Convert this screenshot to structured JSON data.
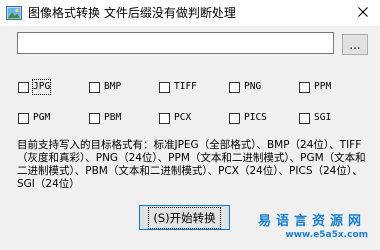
{
  "window": {
    "title": "图像格式转换 文件后缀没有做判断处理",
    "app_icon": "image-app-icon",
    "close_icon": "close-icon"
  },
  "path_input": {
    "value": "",
    "placeholder": ""
  },
  "browse_button": {
    "label": "..."
  },
  "formats": {
    "row1": [
      {
        "label": "JPG",
        "checked": false
      },
      {
        "label": "BMP",
        "checked": false
      },
      {
        "label": "TIFF",
        "checked": false
      },
      {
        "label": "PNG",
        "checked": false
      },
      {
        "label": "PPM",
        "checked": false
      }
    ],
    "row2": [
      {
        "label": "PGM",
        "checked": false
      },
      {
        "label": "PBM",
        "checked": false
      },
      {
        "label": "PCX",
        "checked": false
      },
      {
        "label": "PICS",
        "checked": false
      },
      {
        "label": "SGI",
        "checked": false
      }
    ]
  },
  "info_text": "目前支持写入的目标格式有：标准JPEG（全部格式）、BMP（24位）、TIFF（灰度和真彩）、PNG（24位）、PPM（文本和二进制模式）、PGM（文本和二进制模式）、PBM（文本和二进制模式）、PCX（24位）、PICS（24位）、SGI（24位）",
  "start_button": {
    "label": "(S)开始转换"
  },
  "watermark": {
    "line1": "易语言资源网",
    "line2": "www.e5a5x.com"
  },
  "colors": {
    "focus_border": "#0078d7",
    "watermark": "#1a7fd0"
  }
}
